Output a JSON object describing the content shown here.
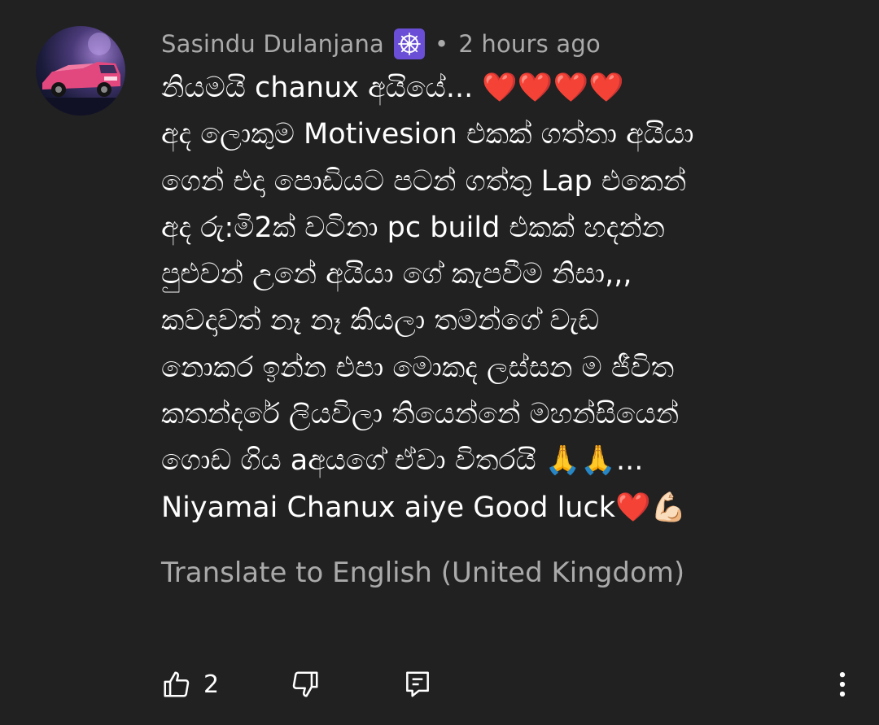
{
  "comment": {
    "author": "Sasindu Dulanjana",
    "badge_icon": "dharma-wheel-icon",
    "separator": "•",
    "time": "2 hours ago",
    "text": "නියමයි chanux අයියේ... ❤️❤️❤️❤️\nඅද ලොකුම Motivesion එකක් ගත්තා අයියා\nගෙන් එදා පොඩියට පටන් ගත්තු Lap එකෙන්\nඅද රු:මි2ක් වටිනා pc build එකක් හදන්න\nපුළුවන් උනේ අයියා ගේ කැපවීම නිසා,,,\nකවදාවත් නෑ නෑ කියලා තමන්ගේ වැඩ\nනොකර ඉන්න එපා මොකද ලස්සන ම ජීවිත\nකතන්දරේ ලියවිලා තියෙන්නේ මහන්සියෙන්\nගොඩ ගිය aඅයගේ ඒවා විතරයි 🙏🙏...\nNiyamai Chanux aiye Good luck❤️💪🏻",
    "translate_label": "Translate to English (United Kingdom)",
    "like_count": "2"
  },
  "colors": {
    "background": "#212121",
    "primary_text": "#ffffff",
    "secondary_text": "#aaaaaa",
    "badge_bg": "#6a4fd6"
  },
  "icons": {
    "like": "thumbs-up-icon",
    "dislike": "thumbs-down-icon",
    "reply": "reply-comment-icon",
    "more": "more-vert-icon"
  }
}
